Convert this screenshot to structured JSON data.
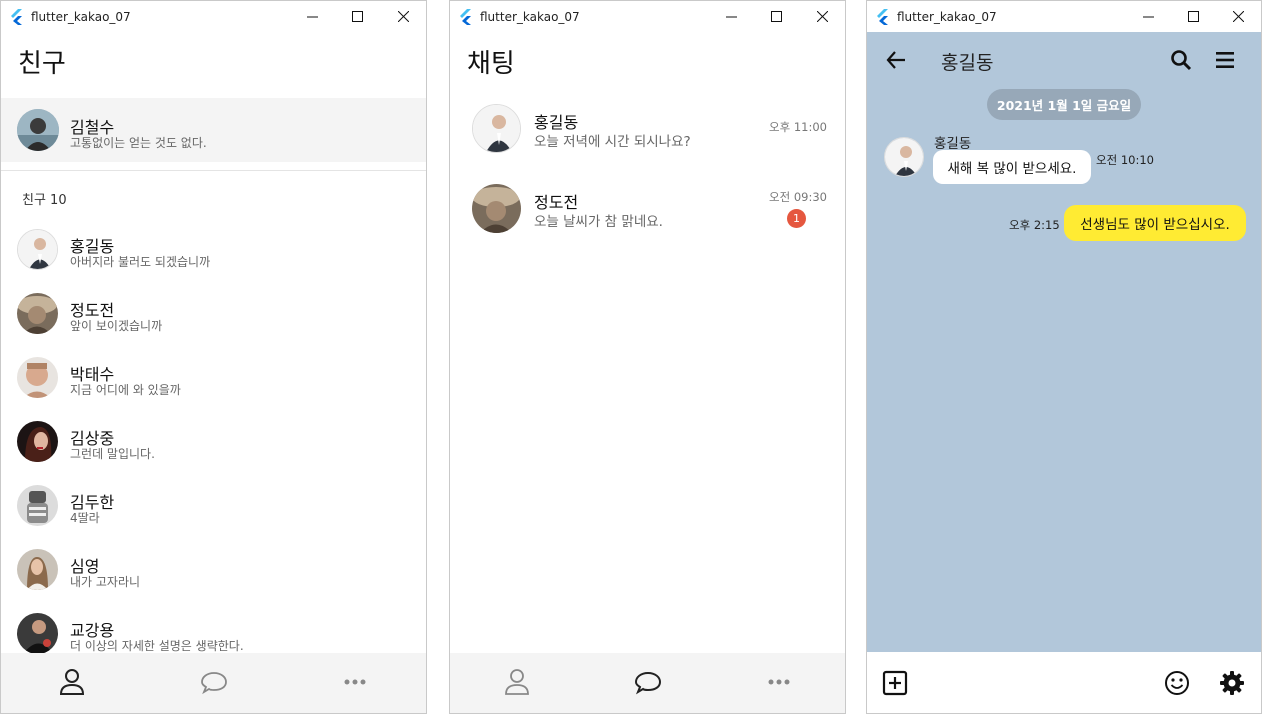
{
  "window_title": "flutter_kakao_07",
  "friends": {
    "title": "친구",
    "me": {
      "name": "김철수",
      "status": "고통없이는 얻는 것도 없다."
    },
    "section_label": "친구 10",
    "items": [
      {
        "name": "홍길동",
        "status": "아버지라 불러도 되겠습니까"
      },
      {
        "name": "정도전",
        "status": "앞이 보이겠습니까"
      },
      {
        "name": "박태수",
        "status": "지금 어디에 와 있을까"
      },
      {
        "name": "김상중",
        "status": "그런데 말입니다."
      },
      {
        "name": "김두한",
        "status": "4딸라"
      },
      {
        "name": "심영",
        "status": "내가 고자라니"
      },
      {
        "name": "교강용",
        "status": "더 이상의 자세한 설명은 생략한다."
      }
    ]
  },
  "chats": {
    "title": "채팅",
    "items": [
      {
        "name": "홍길동",
        "message": "오늘 저녁에 시간 되시나요?",
        "time": "오후 11:00",
        "badge": ""
      },
      {
        "name": "정도전",
        "message": "오늘 날씨가 참 맑네요.",
        "time": "오전 09:30",
        "badge": "1"
      }
    ]
  },
  "chatroom": {
    "title": "홍길동",
    "date_chip": "2021년 1월 1일 금요일",
    "incoming": {
      "sender": "홍길동",
      "text": "새해 복 많이 받으세요.",
      "time": "오전 10:10"
    },
    "outgoing": {
      "text": "선생님도 많이 받으십시오.",
      "time": "오후 2:15"
    }
  },
  "colors": {
    "chat_background": "#b2c7da",
    "my_bubble": "#ffeb33",
    "badge": "#e5573f",
    "date_chip": "#97a8b8",
    "bottom_nav": "#f4f4f4"
  },
  "icons": [
    "flutter-logo-icon",
    "minimize-icon",
    "maximize-icon",
    "close-icon",
    "person-icon",
    "chat-bubble-icon",
    "more-icon",
    "back-arrow-icon",
    "search-icon",
    "menu-icon",
    "add-box-icon",
    "emoji-icon",
    "settings-icon"
  ]
}
